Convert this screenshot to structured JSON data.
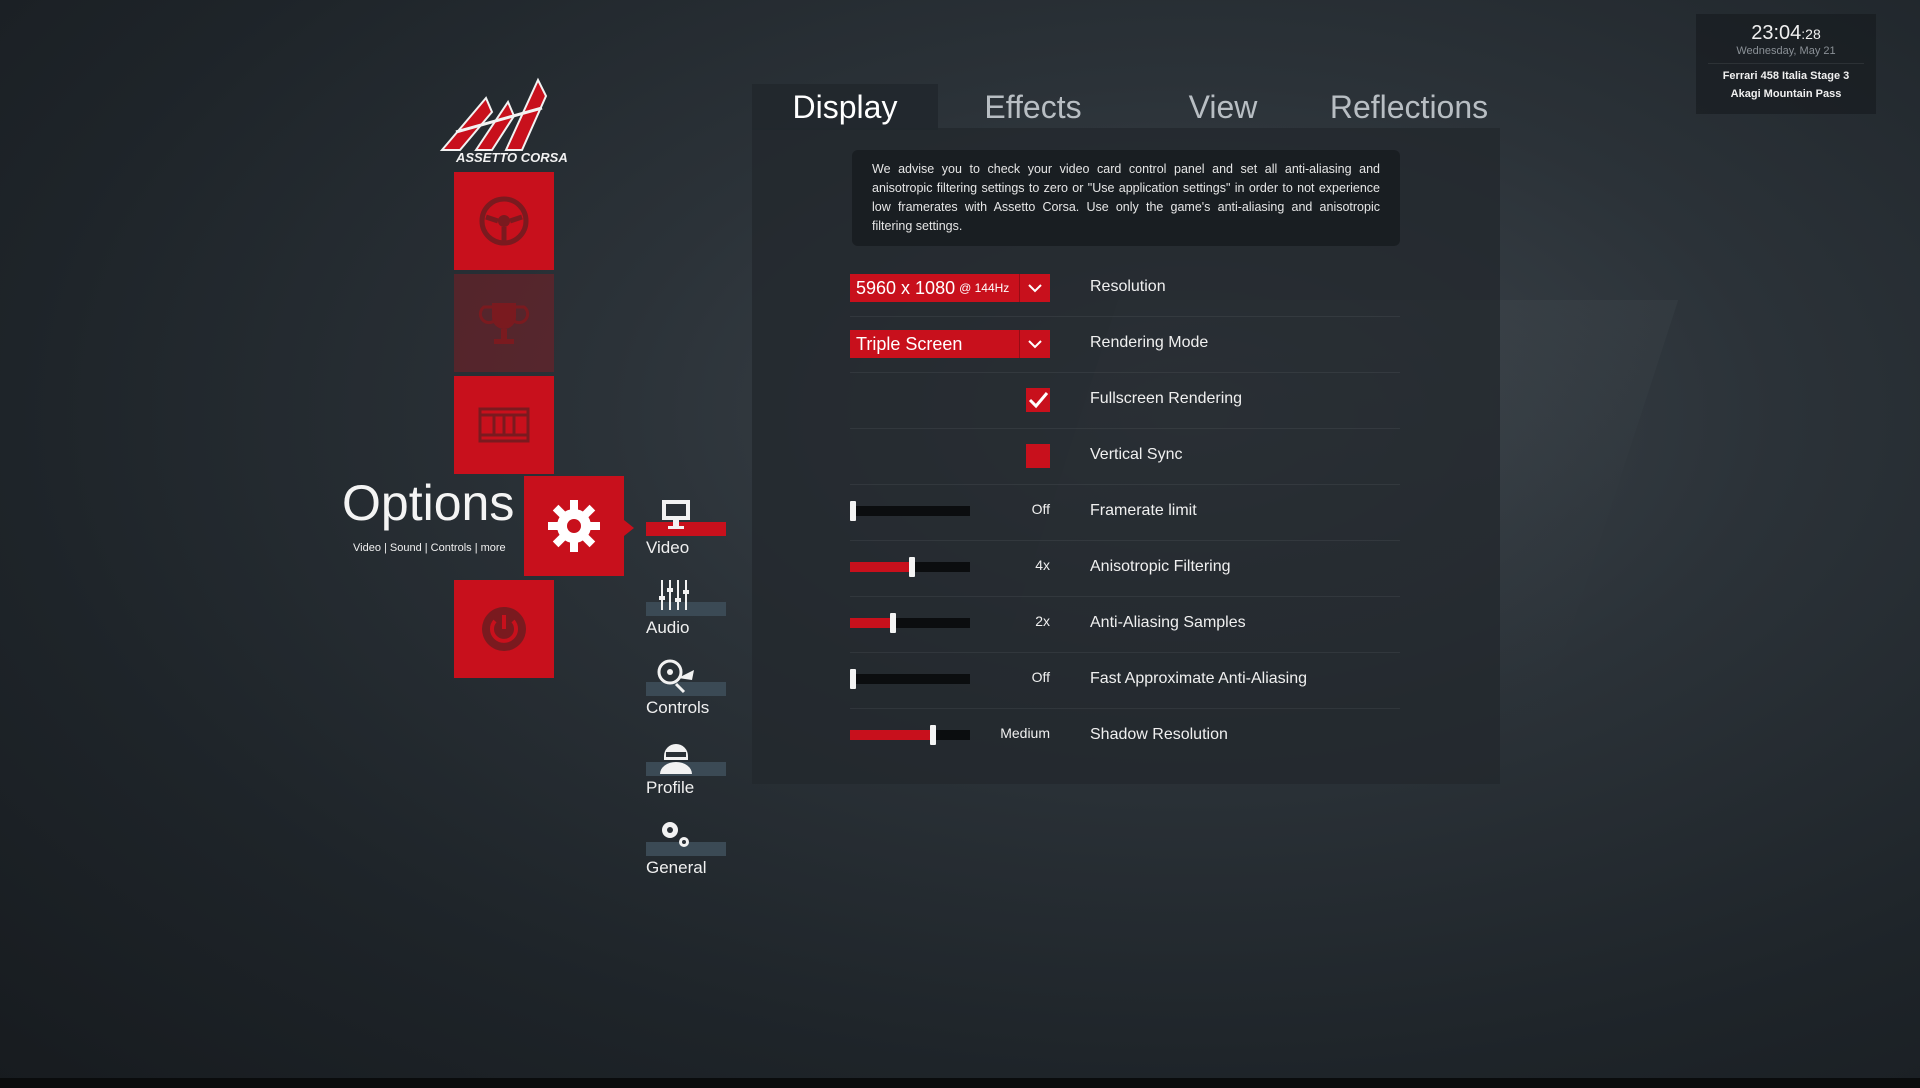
{
  "clock": {
    "time_hm": "23:04",
    "time_s": ":28",
    "date": "Wednesday, May 21",
    "car": "Ferrari 458 Italia Stage 3",
    "track": "Akagi Mountain Pass"
  },
  "logo": {
    "text": "ASSETTO CORSA",
    "icon": "assetto-corsa-logo"
  },
  "main_menu": {
    "tiles": [
      {
        "icon": "steering-wheel-icon"
      },
      {
        "icon": "trophy-icon"
      },
      {
        "icon": "film-strip-icon"
      },
      {
        "icon": "power-icon"
      }
    ],
    "options_title": "Options",
    "options_subtitle": "Video | Sound | Controls | more",
    "options_icon": "gear-icon"
  },
  "sub_menu": {
    "items": [
      {
        "label": "Video",
        "icon": "monitor-icon",
        "active": true
      },
      {
        "label": "Audio",
        "icon": "mixer-icon",
        "active": false
      },
      {
        "label": "Controls",
        "icon": "controls-icon",
        "active": false
      },
      {
        "label": "Profile",
        "icon": "driver-helmet-icon",
        "active": false
      },
      {
        "label": "General",
        "icon": "gears-icon",
        "active": false
      }
    ]
  },
  "tabs": [
    {
      "label": "Display",
      "active": true
    },
    {
      "label": "Effects",
      "active": false
    },
    {
      "label": "View",
      "active": false
    },
    {
      "label": "Reflections",
      "active": false
    }
  ],
  "notice": "We advise you to check your video card control panel and set all anti-aliasing and anisotropic filtering settings to zero or \"Use application settings\" in order to not experience low framerates with Assetto Corsa. Use only the game's anti-aliasing and anisotropic filtering settings.",
  "settings": {
    "resolution": {
      "value": "5960 x 1080",
      "refresh": "@ 144Hz",
      "label": "Resolution"
    },
    "rendering_mode": {
      "value": "Triple Screen",
      "label": "Rendering Mode"
    },
    "fullscreen": {
      "checked": true,
      "label": "Fullscreen Rendering"
    },
    "vsync": {
      "checked": false,
      "label": "Vertical Sync"
    },
    "framerate_limit": {
      "value": "Off",
      "level": 0.0,
      "label": "Framerate limit"
    },
    "anisotropic": {
      "value": "4x",
      "level": 0.52,
      "label": "Anisotropic Filtering"
    },
    "anti_aliasing": {
      "value": "2x",
      "level": 0.36,
      "label": "Anti-Aliasing Samples"
    },
    "fxaa": {
      "value": "Off",
      "level": 0.0,
      "label": "Fast Approximate Anti-Aliasing"
    },
    "shadow_resolution": {
      "value": "Medium",
      "level": 0.69,
      "label": "Shadow Resolution"
    }
  },
  "colors": {
    "accent": "#c8101c",
    "panel": "#22282d",
    "slider_track": "#0b0d0f"
  }
}
